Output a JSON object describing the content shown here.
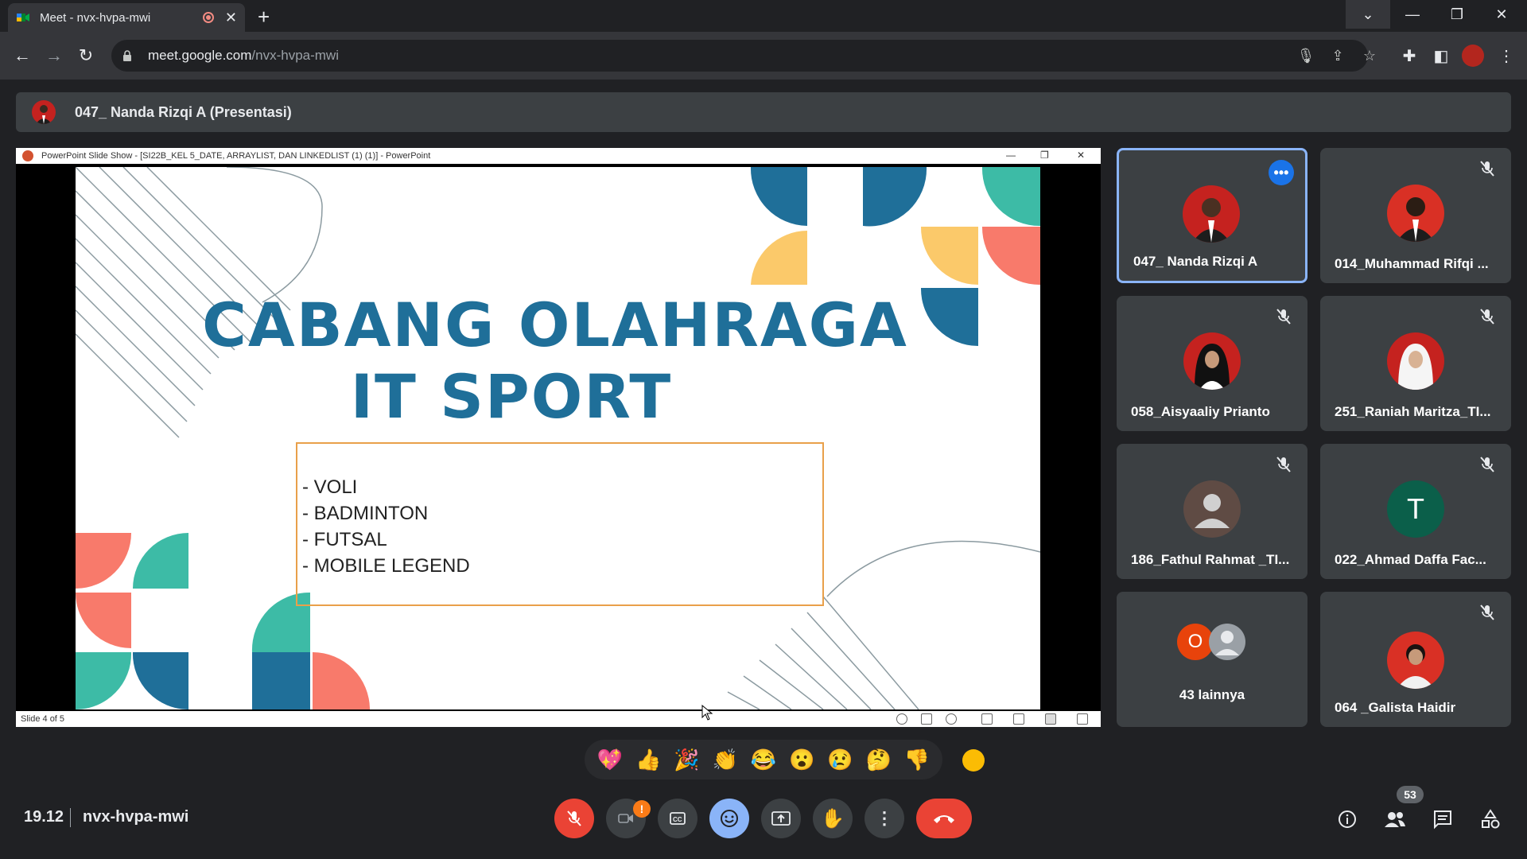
{
  "browser": {
    "tab_title": "Meet - nvx-hvpa-mwi",
    "url_host": "meet.google.com",
    "url_path": "/nvx-hvpa-mwi"
  },
  "presenter": {
    "name": "047_ Nanda Rizqi A (Presentasi)"
  },
  "powerpoint": {
    "window_title": "PowerPoint Slide Show - [SI22B_KEL 5_DATE, ARRAYLIST, DAN LINKEDLIST (1) (1)] - PowerPoint",
    "slide_counter": "Slide 4 of 5",
    "slide_title_line1": "CABANG OLAHRAGA",
    "slide_title_line2": "IT SPORT",
    "bullets": [
      "- VOLI",
      "- BADMINTON",
      "- FUTSAL",
      "- MOBILE LEGEND"
    ],
    "accent_colors": {
      "blue": "#1f6f99",
      "teal": "#3dbba6",
      "coral": "#f87a6b",
      "yellow": "#fbc96a"
    }
  },
  "participants": [
    {
      "name": "047_ Nanda Rizqi A",
      "active": true
    },
    {
      "name": "014_Muhammad Rifqi ..."
    },
    {
      "name": "058_Aisyaaliy Prianto"
    },
    {
      "name": "251_Raniah Maritza_TI..."
    },
    {
      "name": "186_Fathul Rahmat _TI..."
    },
    {
      "name": "022_Ahmad Daffa Fac...",
      "initial": "T"
    },
    {
      "name": "43 lainnya",
      "initial": "O"
    },
    {
      "name": "064 _Galista Haidir"
    }
  ],
  "reactions": [
    "💖",
    "👍",
    "🎉",
    "👏",
    "😂",
    "😮",
    "😢",
    "🤔",
    "👎"
  ],
  "bottom": {
    "time": "19.12",
    "meeting_code": "nvx-hvpa-mwi",
    "participant_count": "53",
    "warning_badge": "!"
  },
  "colors": {
    "hangup": "#ea4335",
    "mic_off": "#ea4335",
    "reaction_active": "#8ab4f8",
    "tile_highlight": "#8ab4f8"
  }
}
